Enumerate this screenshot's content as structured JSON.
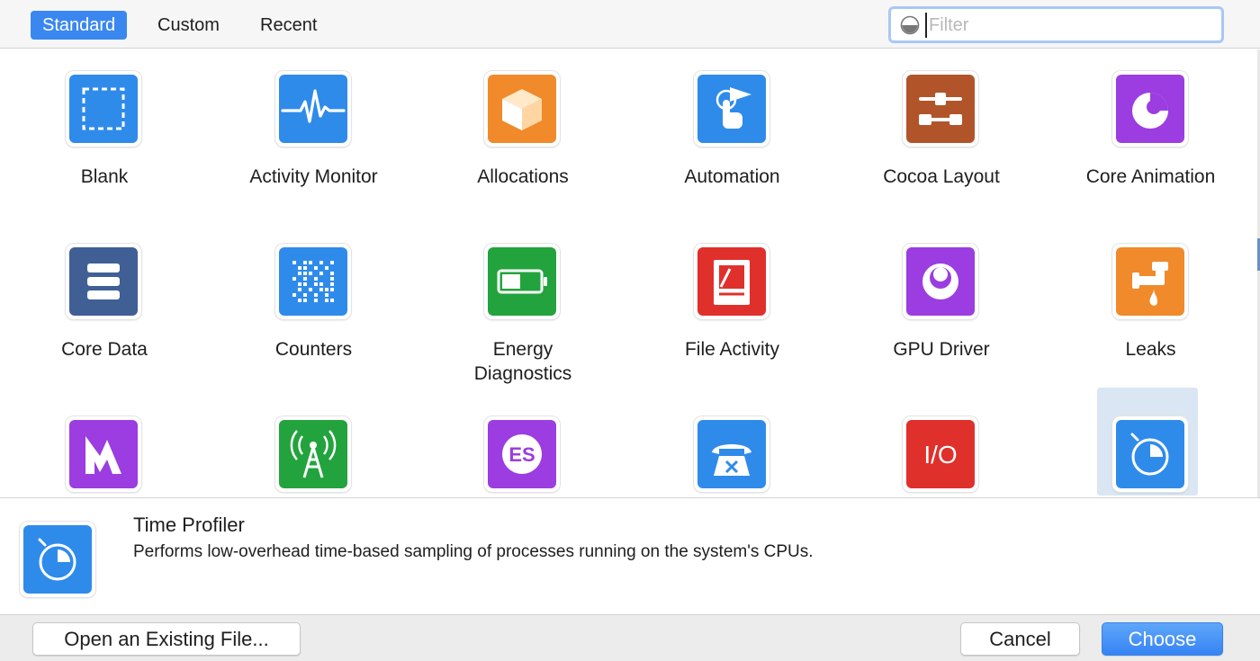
{
  "toolbar": {
    "tabs": [
      {
        "label": "Standard",
        "active": true
      },
      {
        "label": "Custom",
        "active": false
      },
      {
        "label": "Recent",
        "active": false
      }
    ],
    "filter_placeholder": "Filter"
  },
  "templates": [
    {
      "label": "Blank",
      "icon": "blank-icon",
      "color": "#2f8bea"
    },
    {
      "label": "Activity Monitor",
      "icon": "activity-monitor-icon",
      "color": "#2f8bea"
    },
    {
      "label": "Allocations",
      "icon": "allocations-icon",
      "color": "#f08a2a"
    },
    {
      "label": "Automation",
      "icon": "automation-icon",
      "color": "#2f8bea"
    },
    {
      "label": "Cocoa Layout",
      "icon": "cocoa-layout-icon",
      "color": "#b2542a"
    },
    {
      "label": "Core Animation",
      "icon": "core-animation-icon",
      "color": "#9b3de0"
    },
    {
      "label": "Core Data",
      "icon": "core-data-icon",
      "color": "#3f5f95"
    },
    {
      "label": "Counters",
      "icon": "counters-icon",
      "color": "#2f8bea"
    },
    {
      "label": "Energy Diagnostics",
      "icon": "energy-diagnostics-icon",
      "color": "#23a33d"
    },
    {
      "label": "File Activity",
      "icon": "file-activity-icon",
      "color": "#e0302c"
    },
    {
      "label": "GPU Driver",
      "icon": "gpu-driver-icon",
      "color": "#9b3de0"
    },
    {
      "label": "Leaks",
      "icon": "leaks-icon",
      "color": "#f08a2a"
    },
    {
      "label": "",
      "icon": "metal-system-trace-icon",
      "color": "#9b3de0"
    },
    {
      "label": "",
      "icon": "network-icon",
      "color": "#23a33d"
    },
    {
      "label": "",
      "icon": "opengl-es-analysis-icon",
      "color": "#9b3de0"
    },
    {
      "label": "",
      "icon": "system-trace-icon",
      "color": "#2f8bea"
    },
    {
      "label": "",
      "icon": "system-usage-icon",
      "color": "#e0302c"
    },
    {
      "label": "",
      "icon": "time-profiler-icon",
      "color": "#2f8bea",
      "selected": true
    }
  ],
  "detail": {
    "title": "Time Profiler",
    "description": "Performs low-overhead time-based sampling of processes running on the system's CPUs.",
    "icon": "time-profiler-icon"
  },
  "footer": {
    "open_label": "Open an Existing File...",
    "cancel_label": "Cancel",
    "choose_label": "Choose"
  },
  "colors": {
    "accent": "#3a87f0",
    "selection": "#dbe6f4"
  }
}
